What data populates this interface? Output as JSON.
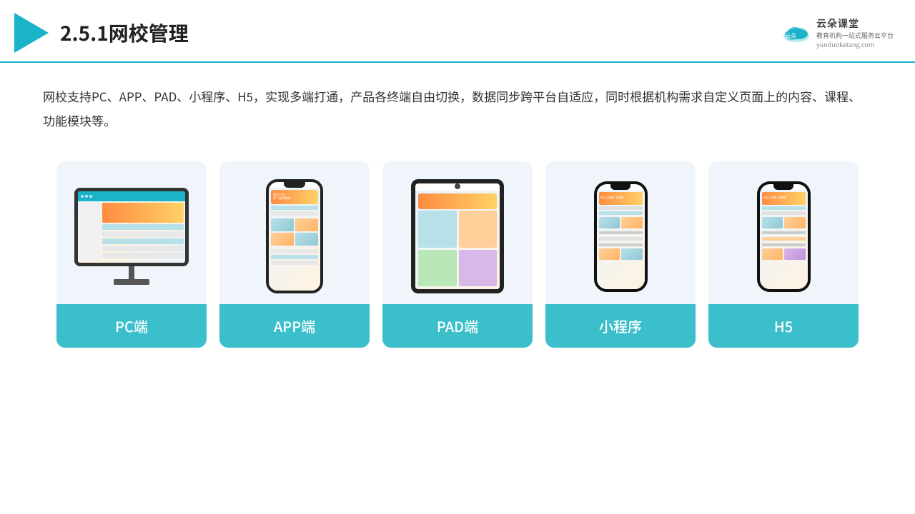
{
  "header": {
    "title": "2.5.1网校管理",
    "brand": {
      "name": "云朵课堂",
      "url": "yunduoketang.com",
      "slogan": "教育机构一站式服务云平台"
    }
  },
  "description": {
    "text": "网校支持PC、APP、PAD、小程序、H5，实现多端打通，产品各终端自由切换，数据同步跨平台自适应，同时根据机构需求自定义页面上的内容、课程、功能模块等。"
  },
  "cards": [
    {
      "id": "pc",
      "label": "PC端"
    },
    {
      "id": "app",
      "label": "APP端"
    },
    {
      "id": "pad",
      "label": "PAD端"
    },
    {
      "id": "miniprogram",
      "label": "小程序"
    },
    {
      "id": "h5",
      "label": "H5"
    }
  ],
  "colors": {
    "accent": "#1ab3c8",
    "card_bg": "#f0f5fc",
    "card_label_bg": "#3bbfca",
    "card_label_text": "#ffffff"
  }
}
